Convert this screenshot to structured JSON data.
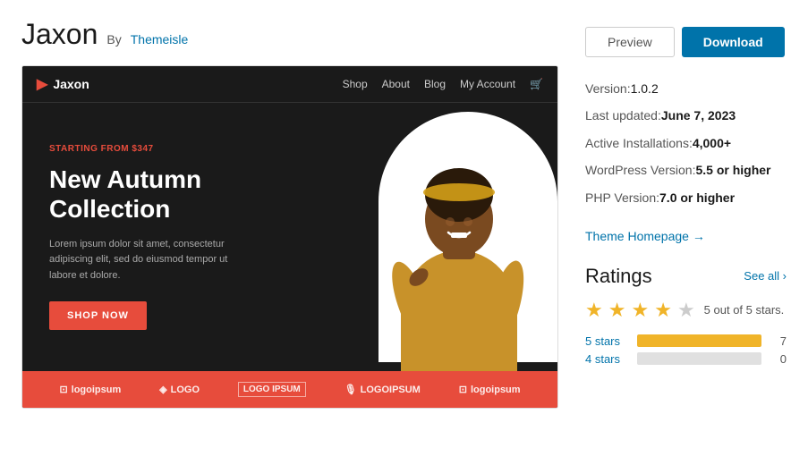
{
  "theme": {
    "name": "Jaxon",
    "by_label": "By",
    "author": "Themeisle",
    "author_color": "#0073aa"
  },
  "buttons": {
    "preview_label": "Preview",
    "download_label": "Download"
  },
  "meta": {
    "version_label": "Version: ",
    "version_value": "1.0.2",
    "last_updated_label": "Last updated: ",
    "last_updated_value": "June 7, 2023",
    "active_installs_label": "Active Installations: ",
    "active_installs_value": "4,000+",
    "wp_version_label": "WordPress Version: ",
    "wp_version_value": "5.5 or higher",
    "php_version_label": "PHP Version: ",
    "php_version_value": "7.0 or higher",
    "homepage_link": "Theme Homepage →"
  },
  "preview": {
    "logo": "Jaxon",
    "nav_shop": "Shop",
    "nav_about": "About",
    "nav_blog": "Blog",
    "nav_account": "My Account",
    "starting_from": "STARTING FROM $347",
    "hero_title": "New Autumn Collection",
    "hero_desc": "Lorem ipsum dolor sit amet, consectetur adipiscing elit, sed do eiusmod tempor ut labore et dolore.",
    "shop_btn": "SHOP NOW",
    "logos": [
      "logoipsum",
      "LOGO",
      "LOGO IPSUM",
      "LOGOIPSUM",
      "logoipsum"
    ]
  },
  "ratings": {
    "title": "Ratings",
    "see_all": "See all ›",
    "summary": "5 out of 5 stars.",
    "stars_filled": 4,
    "stars_empty": 1,
    "bars": [
      {
        "label": "5 stars",
        "count": 7,
        "max": 7
      },
      {
        "label": "4 stars",
        "count": 0,
        "max": 7
      }
    ]
  }
}
